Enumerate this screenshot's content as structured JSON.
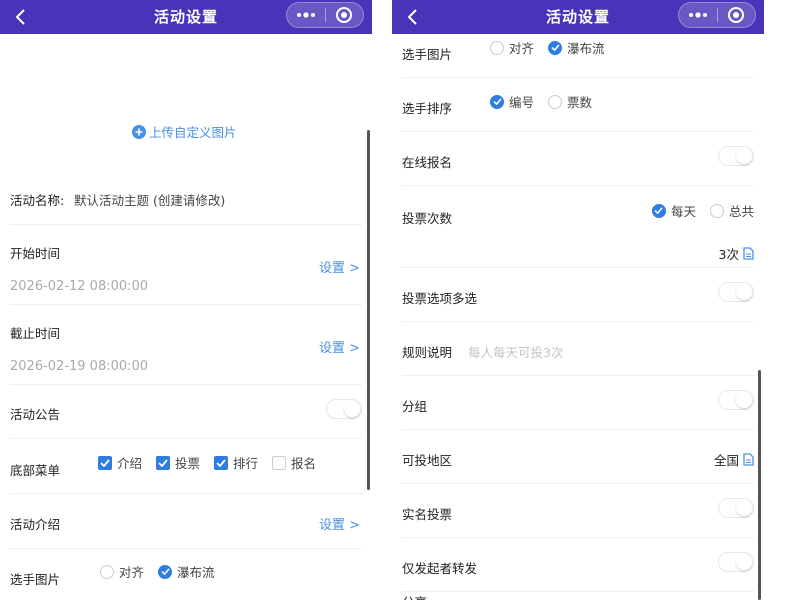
{
  "left": {
    "nav_title": "活动设置",
    "upload_link": "上传自定义图片",
    "activity_name_label": "活动名称:",
    "activity_name_value": "默认活动主题 (创建请修改)",
    "start_time_label": "开始时间",
    "start_time_value": "2026-02-12 08:00:00",
    "start_set": "设置 >",
    "end_time_label": "截止时间",
    "end_time_value": "2026-02-19 08:00:00",
    "end_set": "设置 >",
    "notice_label": "活动公告",
    "menu_label": "底部菜单",
    "menu_options": [
      "介绍",
      "投票",
      "排行",
      "报名"
    ],
    "intro_label": "活动介绍",
    "intro_set": "设置 >",
    "image_label": "选手图片",
    "image_options": [
      "对齐",
      "瀑布流"
    ]
  },
  "right": {
    "nav_title": "活动设置",
    "image_label": "选手图片",
    "image_options": [
      "对齐",
      "瀑布流"
    ],
    "sort_label": "选手排序",
    "sort_options": [
      "编号",
      "票数"
    ],
    "signup_label": "在线报名",
    "votes_label": "投票次数",
    "votes_options": [
      "每天",
      "总共"
    ],
    "votes_count": "3次",
    "multi_label": "投票选项多选",
    "rules_label": "规则说明",
    "rules_placeholder": "每人每天可投3次",
    "group_label": "分组",
    "region_label": "可投地区",
    "region_value": "全国",
    "realname_label": "实名投票",
    "forward_label": "仅发起者转发",
    "share_label": "分享"
  },
  "colors": {
    "navbar": "#4834b8",
    "accent": "#2f7de1",
    "link": "#4a90e2"
  }
}
